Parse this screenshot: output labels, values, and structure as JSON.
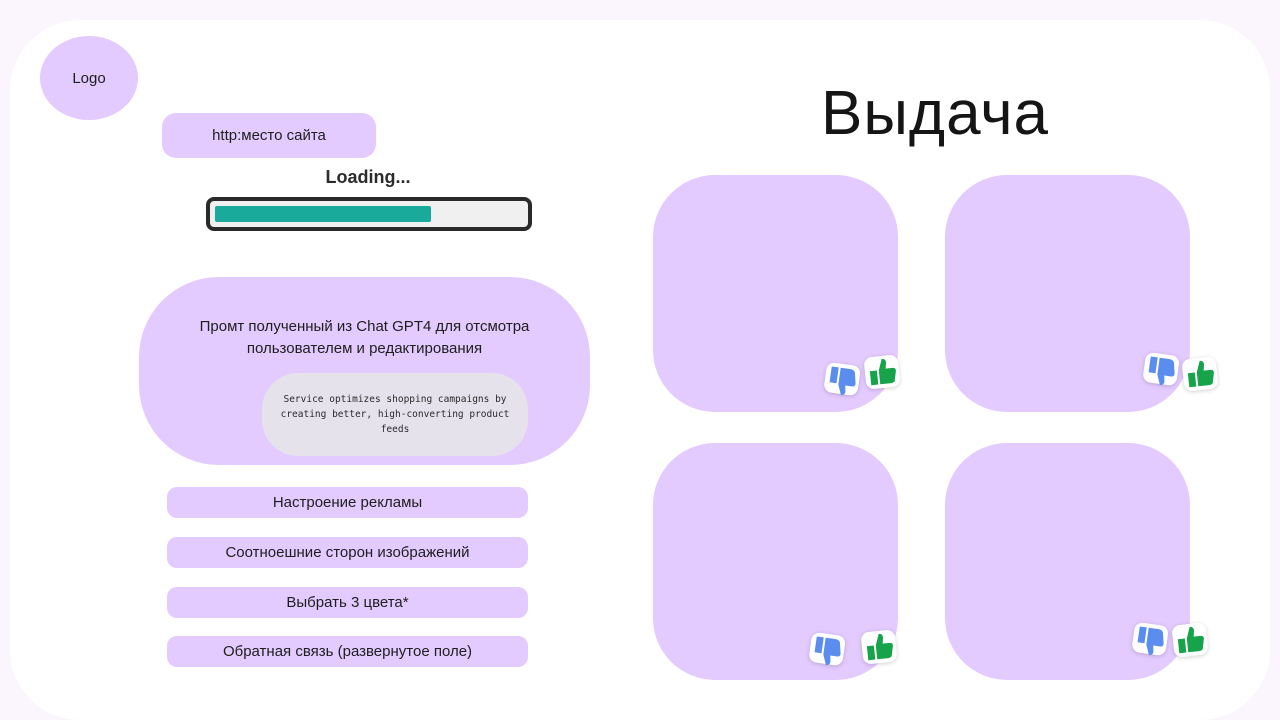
{
  "logo": {
    "label": "Logo"
  },
  "url_field": {
    "value": "http:место сайта"
  },
  "loading": {
    "label": "Loading...",
    "progress": 0.7
  },
  "prompt": {
    "title": "Промт полученный из Chat GPT4 для отсмотра пользователем и редактирования",
    "text": "Service optimizes shopping campaigns by creating better, high-converting product feeds"
  },
  "options": [
    {
      "label": "Настроение рекламы"
    },
    {
      "label": "Соотноешние сторон изображений"
    },
    {
      "label": "Выбрать 3 цвета*"
    },
    {
      "label": "Обратная связь (развернутое поле)"
    }
  ],
  "results": {
    "title": "Выдача",
    "cards": [
      {
        "thumb_down_icon": "thumbs-down-icon",
        "thumb_up_icon": "thumbs-up-icon"
      },
      {
        "thumb_down_icon": "thumbs-down-icon",
        "thumb_up_icon": "thumbs-up-icon"
      },
      {
        "thumb_down_icon": "thumbs-down-icon",
        "thumb_up_icon": "thumbs-up-icon"
      },
      {
        "thumb_down_icon": "thumbs-down-icon",
        "thumb_up_icon": "thumbs-up-icon"
      }
    ]
  },
  "colors": {
    "background": "#fbf5fd",
    "panel": "#ffffff",
    "accent_lavender": "#e3caff",
    "progress_fill": "#1aaa9c",
    "thumbs_down": "#5b8def",
    "thumbs_up": "#16a34a"
  }
}
